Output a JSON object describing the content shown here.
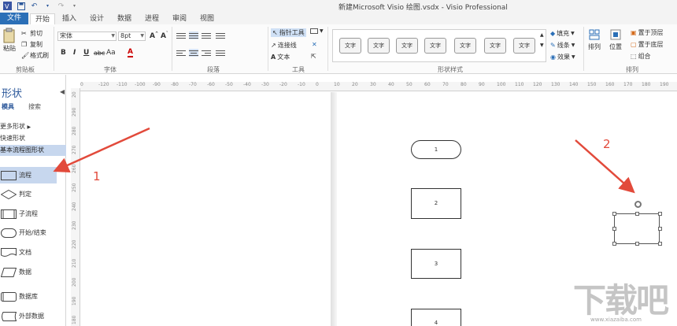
{
  "window": {
    "title": "新建Microsoft Visio 绘图.vsdx - Visio Professional"
  },
  "tabs": [
    {
      "label": "文件"
    },
    {
      "label": "开始"
    },
    {
      "label": "插入"
    },
    {
      "label": "设计"
    },
    {
      "label": "数据"
    },
    {
      "label": "进程"
    },
    {
      "label": "审阅"
    },
    {
      "label": "视图"
    }
  ],
  "ribbon": {
    "clipboard": {
      "paste": "粘贴",
      "cut": "剪切",
      "copy": "复制",
      "format_painter": "格式刷",
      "label": "剪贴板"
    },
    "font": {
      "font_name": "宋体",
      "font_size": "8pt",
      "bold": "B",
      "italic": "I",
      "underline": "U",
      "strike": "abc",
      "case": "Aa",
      "color": "A",
      "label": "字体"
    },
    "paragraph": {
      "label": "段落"
    },
    "tools": {
      "pointer": "指针工具",
      "connector": "连接线",
      "text": "文本",
      "label": "工具"
    },
    "shape_styles": {
      "items": [
        "文字",
        "文字",
        "文字",
        "文字",
        "文字",
        "文字",
        "文字"
      ],
      "label": "形状样式"
    },
    "shape_format": {
      "fill": "填充",
      "line": "线条",
      "effects": "效果"
    },
    "arrange": {
      "arrange": "排列",
      "position": "位置",
      "bring_front": "置于顶层",
      "send_back": "置于底层",
      "group": "组合",
      "label": "排列"
    }
  },
  "shapes_panel": {
    "title": "形状",
    "tabs": [
      "模具",
      "搜索"
    ],
    "more_shapes": "更多形状",
    "quick_shapes": "快速形状",
    "category": "基本流程图形状",
    "items": [
      {
        "label": "流程"
      },
      {
        "label": "判定"
      },
      {
        "label": "子流程"
      },
      {
        "label": "开始/结束"
      },
      {
        "label": "文档"
      },
      {
        "label": "数据"
      },
      {
        "label": "数据库"
      },
      {
        "label": "外部数据"
      }
    ]
  },
  "ruler": {
    "h_ticks": [
      "0",
      "-120",
      "-110",
      "-100",
      "-90",
      "-80",
      "-70",
      "-60",
      "-50",
      "-40",
      "-30",
      "-20",
      "-10",
      "0",
      "10",
      "20",
      "30",
      "40",
      "50",
      "60",
      "70",
      "80",
      "90",
      "100",
      "110",
      "120",
      "130",
      "140",
      "150",
      "160",
      "170",
      "180",
      "190"
    ],
    "v_ticks": [
      "20",
      "290",
      "280",
      "270",
      "260",
      "250",
      "240",
      "230",
      "220",
      "210",
      "200",
      "190",
      "180"
    ]
  },
  "canvas": {
    "flow_shapes": [
      "1",
      "2",
      "3",
      "4"
    ]
  },
  "annotations": {
    "arrow1_label": "1",
    "arrow2_label": "2"
  },
  "watermark": {
    "text": "下载吧",
    "url": "www.xiazaiba.com"
  },
  "colors": {
    "accent": "#2b579a",
    "file_tab": "#2b6fb7",
    "selection": "#c7d7ee",
    "annotation": "#e24a3b"
  }
}
